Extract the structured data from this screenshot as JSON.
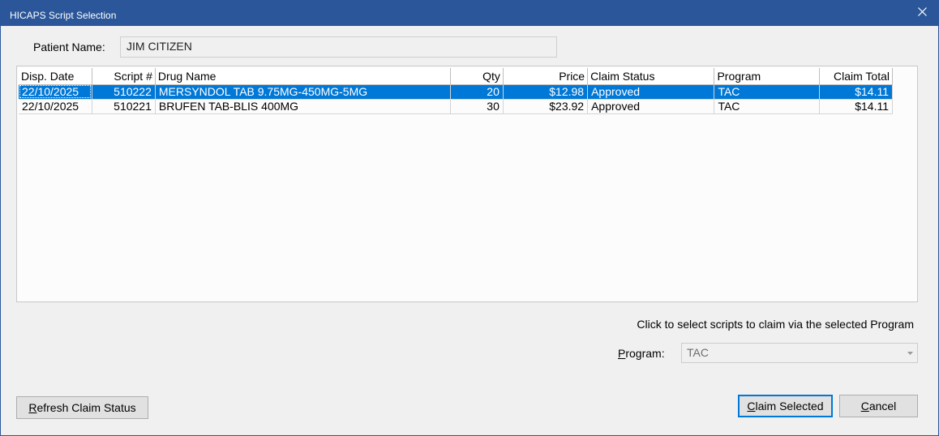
{
  "window": {
    "title": "HICAPS Script Selection",
    "close_icon": "close-icon",
    "accent_color": "#2b579a"
  },
  "patient": {
    "label": "Patient Name:",
    "value": "JIM CITIZEN"
  },
  "grid": {
    "columns": [
      "Disp. Date",
      "Script #",
      "Drug Name",
      "Qty",
      "Price",
      "Claim Status",
      "Program",
      "Claim Total"
    ],
    "rows": [
      [
        "22/10/2025",
        "510222",
        "MERSYNDOL TAB 9.75MG-450MG-5MG",
        "20",
        "$12.98",
        "Approved",
        "TAC",
        "$14.11"
      ],
      [
        "22/10/2025",
        "510221",
        "BRUFEN TAB-BLIS 400MG",
        "30",
        "$23.92",
        "Approved",
        "TAC",
        "$14.11"
      ]
    ],
    "selected_row": 0,
    "selection_color": "#0078d7"
  },
  "hint": "Click to select scripts to claim via the selected Program",
  "program": {
    "label_accel": "P",
    "label_rest": "rogram:",
    "value": "TAC",
    "arrow_icon": "chevron-down-icon"
  },
  "buttons": {
    "refresh": {
      "accel": "R",
      "rest": "efresh Claim Status"
    },
    "claim": {
      "accel": "C",
      "rest": "laim Selected"
    },
    "cancel": {
      "pre": "",
      "accel": "C",
      "rest": "ancel"
    }
  }
}
